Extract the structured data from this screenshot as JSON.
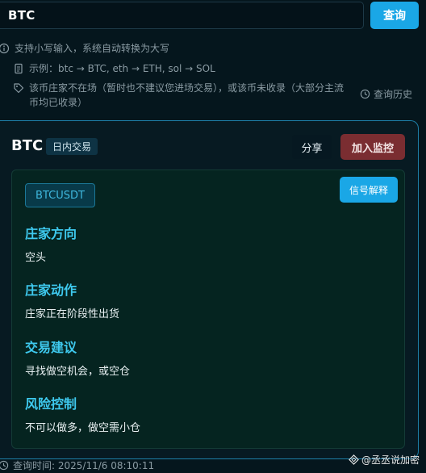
{
  "search": {
    "value": "BTC",
    "button_label": "查询"
  },
  "hints": {
    "input_tip": "支持小写输入，系统自动转换为大写",
    "example": "示例：btc → BTC, eth → ETH, sol → SOL",
    "note": "该币庄家不在场（暂时也不建议您进场交易），或该币未收录（大部分主流币均已收录）"
  },
  "history_label": "查询历史",
  "result": {
    "coin": "BTC",
    "mode_tag": "日内交易",
    "share_label": "分享",
    "monitor_label": "加入监控",
    "pair": "BTCUSDT",
    "explain_label": "信号解释",
    "sections": [
      {
        "title": "庄家方向",
        "value": "空头"
      },
      {
        "title": "庄家动作",
        "value": "庄家正在阶段性出货"
      },
      {
        "title": "交易建议",
        "value": "寻找做空机会，或空仓"
      },
      {
        "title": "风险控制",
        "value": "不可以做多，做空需小仓"
      }
    ]
  },
  "footer": {
    "query_time": "查询时间: 2025/11/6 08:10:11"
  },
  "watermark": "@丞丞说加密",
  "colors": {
    "background": "#05161d",
    "accent": "#1aa7e6",
    "section_title": "#3ec9ee",
    "monitor": "#7a2d31"
  }
}
